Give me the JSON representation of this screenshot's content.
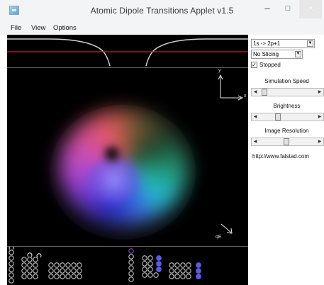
{
  "window": {
    "title": "Atomic Dipole Transitions Applet v1.5",
    "minimize_glyph": "–",
    "maximize_glyph": "□",
    "close_glyph": "✕"
  },
  "menu": {
    "file": "File",
    "view": "View",
    "options": "Options"
  },
  "controls": {
    "transition_select": {
      "value": "1s -> 2p+1"
    },
    "slicing_select": {
      "value": "No Slicing"
    },
    "stopped_checkbox": {
      "label": "Stopped",
      "checked": true
    },
    "simulation_speed": {
      "label": "Simulation Speed",
      "level": 0.05
    },
    "brightness": {
      "label": "Brightness",
      "level": 0.32
    },
    "image_resolution": {
      "label": "Image Resolution",
      "level": 0.48
    },
    "url": "http://www.falstad.com"
  },
  "orbital_view": {
    "axis_y": "y",
    "axis_x": "x",
    "field_label": "qE"
  },
  "colors": {
    "energy_level_line": "#d42020",
    "state_highlight": "#5b5be8",
    "state_selected": "#a050d0"
  }
}
